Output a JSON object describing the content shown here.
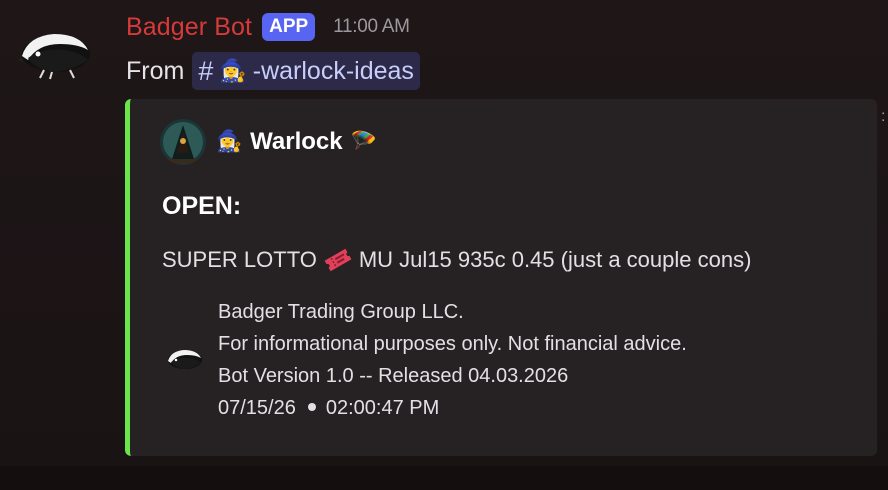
{
  "message": {
    "author": "Badger Bot",
    "badge": "APP",
    "time": "11:00 AM",
    "from_label": "From",
    "channel_prefix": "#",
    "channel_emoji": "🧙‍♀️",
    "channel_name": "-warlock-ideas"
  },
  "embed": {
    "accent_color": "#6be54a",
    "author_emoji": "🧙‍♀️",
    "author_name": "Warlock",
    "author_suffix_emoji": "🪂",
    "title": "OPEN:",
    "desc_prefix": "SUPER LOTTO",
    "desc_icon": "ticket-icon",
    "desc_suffix": "MU Jul15 935c 0.45 (just a couple cons)",
    "footer": {
      "line1": "Badger Trading Group LLC.",
      "line2": "For informational purposes only. Not financial advice.",
      "line3": "Bot Version 1.0 -- Released 04.03.2026",
      "date": "07/15/26",
      "time": "02:00:47 PM"
    }
  },
  "colors": {
    "username": "#d63a3a",
    "app_badge": "#5865f2",
    "channel_pill": "#2c2a48"
  }
}
